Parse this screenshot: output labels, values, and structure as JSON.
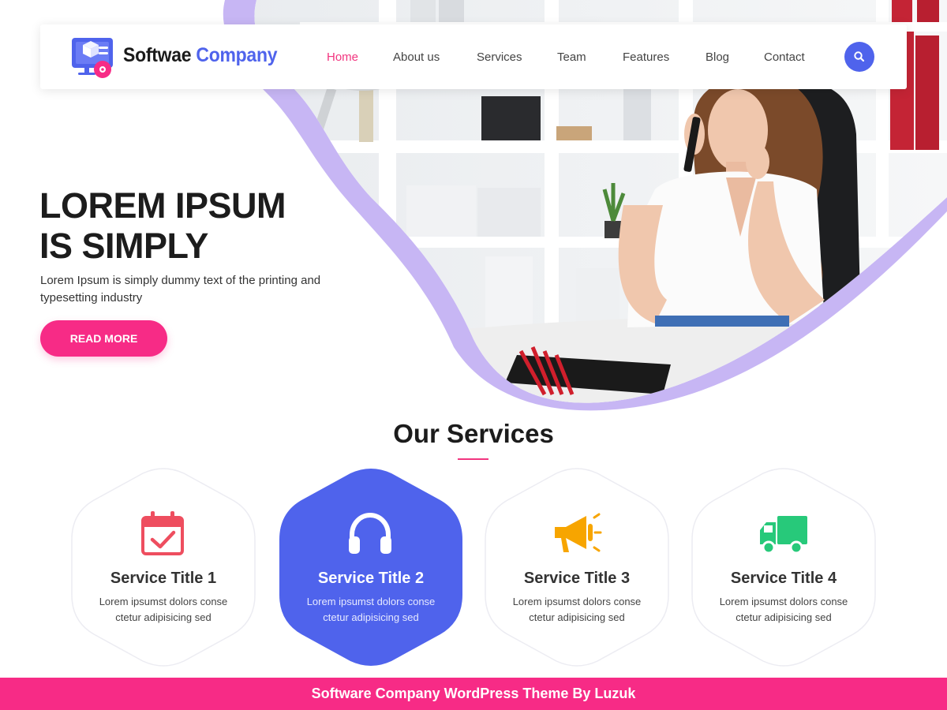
{
  "header": {
    "brand_part1": "Softwae",
    "brand_part2": "Company",
    "nav": [
      {
        "label": "Home",
        "active": true
      },
      {
        "label": "About us",
        "active": false
      },
      {
        "label": "Services",
        "active": false
      },
      {
        "label": "Team",
        "active": false
      },
      {
        "label": "Features",
        "active": false
      },
      {
        "label": "Blog",
        "active": false
      },
      {
        "label": "Contact",
        "active": false
      }
    ],
    "search_icon": "search-icon"
  },
  "hero": {
    "title_line1": "LOREM IPSUM",
    "title_line2": "IS SIMPLY",
    "description": "Lorem Ipsum is simply dummy text of the printing and typesetting industry",
    "cta_label": "READ MORE"
  },
  "services": {
    "heading": "Our Services",
    "items": [
      {
        "title": "Service Title 1",
        "description": "Lorem ipsumst dolors conse ctetur adipisicing sed",
        "icon": "calendar-check-icon",
        "icon_color": "#ee4e5f"
      },
      {
        "title": "Service Title 2",
        "description": "Lorem ipsumst dolors conse ctetur adipisicing sed",
        "icon": "headphones-icon",
        "icon_color": "#ffffff"
      },
      {
        "title": "Service Title 3",
        "description": "Lorem ipsumst dolors conse ctetur adipisicing sed",
        "icon": "megaphone-icon",
        "icon_color": "#f7a500"
      },
      {
        "title": "Service Title 4",
        "description": "Lorem ipsumst dolors conse ctetur adipisicing sed",
        "icon": "truck-icon",
        "icon_color": "#27c97a"
      }
    ]
  },
  "footer": {
    "text": "Software Company WordPress Theme By Luzuk"
  },
  "colors": {
    "primary_blue": "#4f63ec",
    "accent_pink": "#f72b86",
    "wave_purple": "#c7b6f4"
  }
}
